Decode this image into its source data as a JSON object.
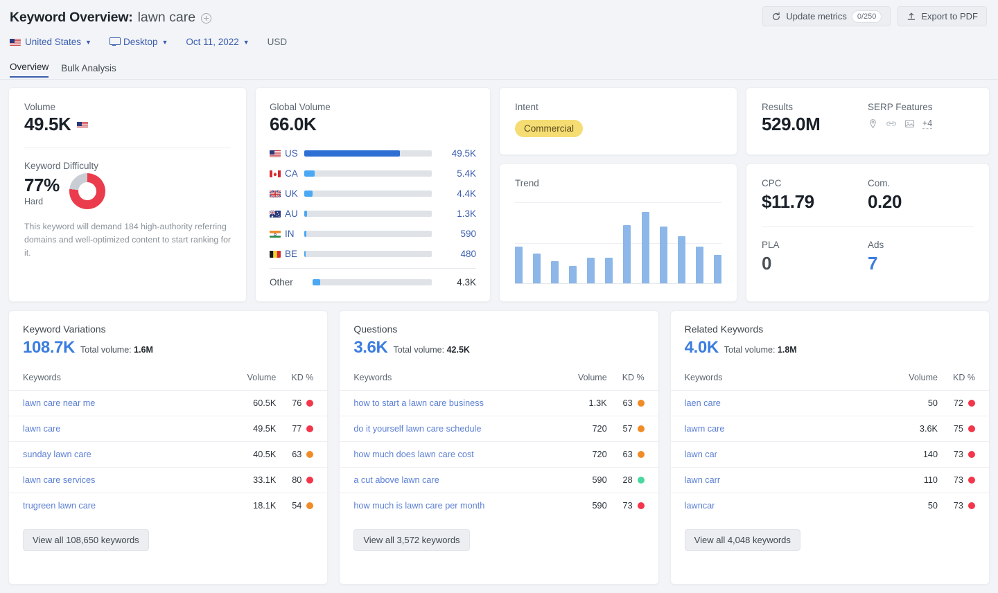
{
  "header": {
    "title_prefix": "Keyword Overview:",
    "keyword": "lawn care",
    "add_icon": "plus-circle-icon",
    "filters": {
      "country": "United States",
      "device": "Desktop",
      "date": "Oct 11, 2022",
      "currency": "USD"
    },
    "tabs": [
      {
        "label": "Overview",
        "active": true
      },
      {
        "label": "Bulk Analysis",
        "active": false
      }
    ],
    "actions": {
      "update_metrics": "Update metrics",
      "update_metrics_count": "0/250",
      "export": "Export to PDF"
    }
  },
  "volume_card": {
    "label": "Volume",
    "value": "49.5K",
    "flag": "us-flag",
    "kd_label": "Keyword Difficulty",
    "kd_value": "77%",
    "kd_percent": 77,
    "kd_rating": "Hard",
    "kd_color": "#eb3c4d",
    "kd_track_color": "#c9ced4",
    "kd_note": "This keyword will demand 184 high-authority referring domains and well-optimized content to start ranking for it."
  },
  "global_volume": {
    "label": "Global Volume",
    "total": "66.0K",
    "rows": [
      {
        "code": "US",
        "flag": "us-flag",
        "value": "49.5K",
        "pct": 75,
        "color": "#2e6fd4"
      },
      {
        "code": "CA",
        "flag": "ca-flag",
        "value": "5.4K",
        "pct": 8.2,
        "color": "#4aa8f5"
      },
      {
        "code": "UK",
        "flag": "uk-flag",
        "value": "4.4K",
        "pct": 6.7,
        "color": "#4aa8f5"
      },
      {
        "code": "AU",
        "flag": "au-flag",
        "value": "1.3K",
        "pct": 2.0,
        "color": "#4aa8f5"
      },
      {
        "code": "IN",
        "flag": "in-flag",
        "value": "590",
        "pct": 1.4,
        "color": "#4aa8f5"
      },
      {
        "code": "BE",
        "flag": "be-flag",
        "value": "480",
        "pct": 1.3,
        "color": "#4aa8f5"
      }
    ],
    "other": {
      "code": "Other",
      "value": "4.3K",
      "pct": 6.5,
      "color": "#4aa8f5"
    }
  },
  "intent": {
    "label": "Intent",
    "value": "Commercial",
    "badge_bg": "#f5dd74",
    "badge_fg": "#5a4b1c"
  },
  "results": {
    "label": "Results",
    "value": "529.0M",
    "serp_label": "SERP Features",
    "serp_icons": [
      "local-pack-icon",
      "sitelinks-icon",
      "image-pack-icon"
    ],
    "serp_more": "+4"
  },
  "cpc_card": {
    "cpc_label": "CPC",
    "cpc_value": "$11.79",
    "com_label": "Com.",
    "com_value": "0.20",
    "pla_label": "PLA",
    "pla_value": "0",
    "ads_label": "Ads",
    "ads_value": "7"
  },
  "tables": [
    {
      "title": "Keyword Variations",
      "count": "108.7K",
      "total_volume_label": "Total volume:",
      "total_volume": "1.6M",
      "columns": [
        "Keywords",
        "Volume",
        "KD %"
      ],
      "rows": [
        {
          "keyword": "lawn care near me",
          "volume": "60.5K",
          "kd": "76",
          "kd_color": "#f3364b"
        },
        {
          "keyword": "lawn care",
          "volume": "49.5K",
          "kd": "77",
          "kd_color": "#f3364b"
        },
        {
          "keyword": "sunday lawn care",
          "volume": "40.5K",
          "kd": "63",
          "kd_color": "#f08c28"
        },
        {
          "keyword": "lawn care services",
          "volume": "33.1K",
          "kd": "80",
          "kd_color": "#f3364b"
        },
        {
          "keyword": "trugreen lawn care",
          "volume": "18.1K",
          "kd": "54",
          "kd_color": "#f08c28"
        }
      ],
      "view_all": "View all 108,650 keywords"
    },
    {
      "title": "Questions",
      "count": "3.6K",
      "total_volume_label": "Total volume:",
      "total_volume": "42.5K",
      "columns": [
        "Keywords",
        "Volume",
        "KD %"
      ],
      "rows": [
        {
          "keyword": "how to start a lawn care business",
          "volume": "1.3K",
          "kd": "63",
          "kd_color": "#f08c28"
        },
        {
          "keyword": "do it yourself lawn care schedule",
          "volume": "720",
          "kd": "57",
          "kd_color": "#f08c28"
        },
        {
          "keyword": "how much does lawn care cost",
          "volume": "720",
          "kd": "63",
          "kd_color": "#f08c28"
        },
        {
          "keyword": "a cut above lawn care",
          "volume": "590",
          "kd": "28",
          "kd_color": "#4cd7a0"
        },
        {
          "keyword": "how much is lawn care per month",
          "volume": "590",
          "kd": "73",
          "kd_color": "#f3364b"
        }
      ],
      "view_all": "View all 3,572 keywords"
    },
    {
      "title": "Related Keywords",
      "count": "4.0K",
      "total_volume_label": "Total volume:",
      "total_volume": "1.8M",
      "columns": [
        "Keywords",
        "Volume",
        "KD %"
      ],
      "rows": [
        {
          "keyword": "laen care",
          "volume": "50",
          "kd": "72",
          "kd_color": "#f3364b"
        },
        {
          "keyword": "lawm care",
          "volume": "3.6K",
          "kd": "75",
          "kd_color": "#f3364b"
        },
        {
          "keyword": "lawn car",
          "volume": "140",
          "kd": "73",
          "kd_color": "#f3364b"
        },
        {
          "keyword": "lawn carr",
          "volume": "110",
          "kd": "73",
          "kd_color": "#f3364b"
        },
        {
          "keyword": "lawncar",
          "volume": "50",
          "kd": "73",
          "kd_color": "#f3364b"
        }
      ],
      "view_all": "View all 4,048 keywords"
    }
  ],
  "chart_data": {
    "type": "bar",
    "title": "Trend",
    "categories": [
      "1",
      "2",
      "3",
      "4",
      "5",
      "6",
      "7",
      "8",
      "9",
      "10",
      "11",
      "12"
    ],
    "values": [
      45,
      37,
      27,
      21,
      32,
      32,
      72,
      88,
      70,
      58,
      45,
      35
    ],
    "xlabel": "",
    "ylabel": "",
    "ylim": [
      0,
      100
    ],
    "grid": true,
    "legend": "none",
    "bar_color": "#8cb7e8"
  }
}
